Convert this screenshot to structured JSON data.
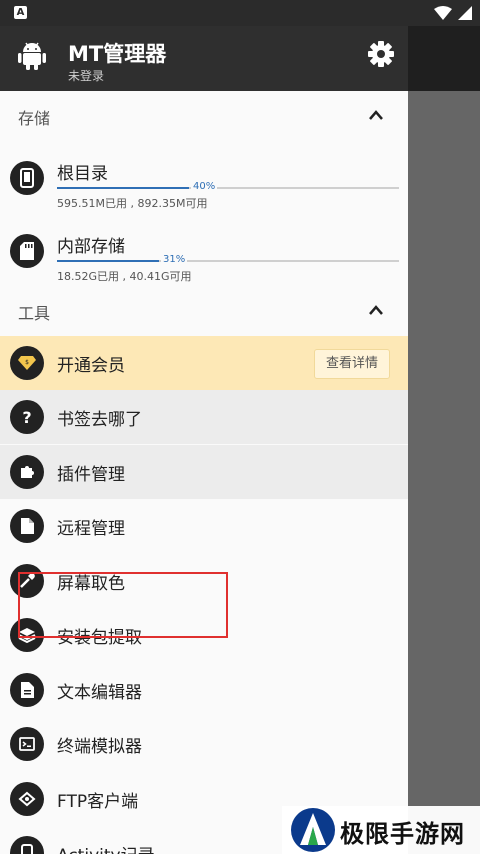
{
  "status_bar": {
    "left_icon": "A"
  },
  "app": {
    "title": "MT管理器",
    "subtitle": "未登录"
  },
  "sections": {
    "storage": {
      "title": "存储"
    },
    "tools": {
      "title": "工具"
    }
  },
  "storage_items": [
    {
      "label": "根目录",
      "percent_text": "40%",
      "percent": 40,
      "detail": "595.51M已用 , 892.35M可用"
    },
    {
      "label": "内部存储",
      "percent_text": "31%",
      "percent": 31,
      "detail": "18.52G已用 , 40.41G可用"
    }
  ],
  "tools": {
    "vip": {
      "label": "开通会员",
      "button": "查看详情"
    },
    "items": [
      {
        "label": "书签去哪了"
      },
      {
        "label": "插件管理"
      },
      {
        "label": "远程管理"
      },
      {
        "label": "屏幕取色"
      },
      {
        "label": "安装包提取"
      },
      {
        "label": "文本编辑器"
      },
      {
        "label": "终端模拟器"
      },
      {
        "label": "FTP客户端"
      },
      {
        "label": "Activity记录"
      }
    ]
  },
  "watermark": {
    "text": "极限手游网"
  },
  "colors": {
    "appbar": "#2f2f2f",
    "accent": "#2f6fb5",
    "vip_bg": "#fde8b6",
    "highlight": "#e0302f"
  }
}
